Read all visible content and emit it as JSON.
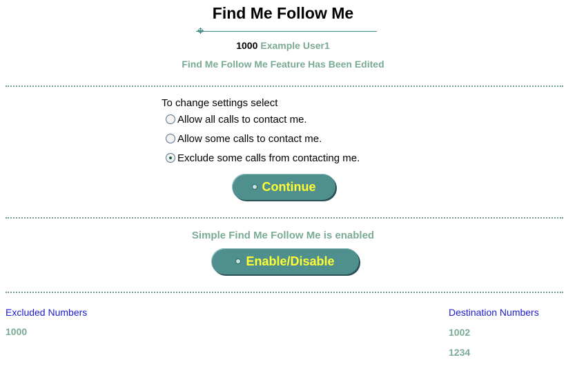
{
  "header": {
    "title": "Find Me Follow Me",
    "extension": "1000",
    "user_name": "Example User1",
    "status_message": "Find Me Follow Me Feature Has Been Edited"
  },
  "settings": {
    "prompt": "To change settings select",
    "options": [
      {
        "label": "Allow all calls to contact me.",
        "selected": false
      },
      {
        "label": "Allow some calls to contact me.",
        "selected": false
      },
      {
        "label": "Exclude some calls from contacting me.",
        "selected": true
      }
    ],
    "continue_label": "Continue"
  },
  "simple": {
    "status": "Simple Find Me Follow Me is enabled",
    "toggle_label": "Enable/Disable"
  },
  "excluded": {
    "header": "Excluded Numbers",
    "numbers": [
      "1000"
    ]
  },
  "destinations": {
    "header": "Destination Numbers",
    "numbers": [
      "1002",
      "1234"
    ]
  },
  "colors": {
    "accent_green": "#7aaa94",
    "button_teal": "#4f8f8e",
    "button_text": "#ffff33",
    "link_blue": "#1a1ad0"
  }
}
